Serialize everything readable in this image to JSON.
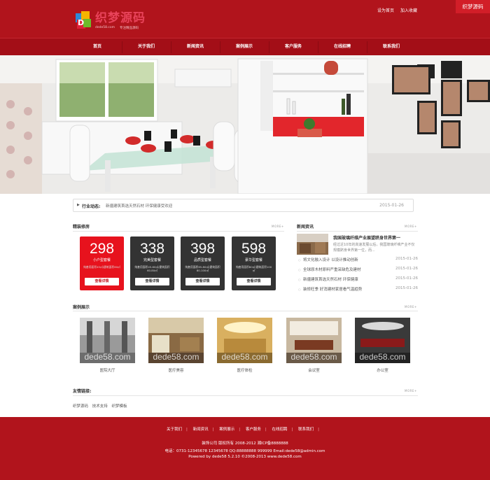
{
  "header": {
    "logo_text": "织梦源码",
    "logo_en": "dede58.com",
    "logo_slogan": "专注精品源码",
    "top_links": [
      "设为首页",
      "加入收藏"
    ],
    "corner_badge": "织梦源码"
  },
  "nav": [
    "首页",
    "关于我们",
    "新闻资讯",
    "案例展示",
    "客户服务",
    "在线招聘",
    "联系我们"
  ],
  "ticker": {
    "label": "行业动态:",
    "text": "新疆建筑首选天然石材 环保健康受欢迎",
    "date": "2015-01-26"
  },
  "packages_section": {
    "title": "精装修房",
    "more": "MORE+",
    "items": [
      {
        "price": "298",
        "name": "小户型套餐",
        "desc": "纯套用面积45㎡/建筑面积60㎡",
        "button": "查看详情"
      },
      {
        "price": "338",
        "name": "完美型套餐",
        "desc": "纯套用面积45-60㎡/建筑面积60-80㎡",
        "button": "查看详情"
      },
      {
        "price": "398",
        "name": "品质型套餐",
        "desc": "纯套用面积65-80㎡/建筑面积80-100㎡",
        "button": "查看详情"
      },
      {
        "price": "598",
        "name": "豪华型套餐",
        "desc": "纯套用面积80㎡/建筑面积100㎡",
        "button": "查看详情"
      }
    ]
  },
  "news_section": {
    "title": "新闻资讯",
    "more": "MORE+",
    "featured": {
      "title": "我国玻璃纤维产业展望跻身世界第一",
      "summary": "经过近10年的高速发展以后，我国玻璃纤维产业不仅规模跻身世界第一位，而..."
    },
    "items": [
      {
        "title": "将文化融入设计 以设计推动创新",
        "date": "2015-01-26"
      },
      {
        "title": "全球原木材原料严重采缺危及建材",
        "date": "2015-01-26"
      },
      {
        "title": "新疆建筑首选天然石材 环保健康",
        "date": "2015-01-26"
      },
      {
        "title": "装修旺季 好消建材家居看气温趋势",
        "date": "2015-01-26"
      }
    ]
  },
  "cases_section": {
    "title": "案例展示",
    "more": "MORE+",
    "watermark": "dede58.com",
    "items": [
      "医院大厅",
      "医疗美容",
      "医疗体检",
      "会议室",
      "办公室"
    ]
  },
  "links_section": {
    "title": "友情链接:",
    "more": "MORE+",
    "items": [
      "织梦源码",
      "技术支持",
      "织梦模板"
    ]
  },
  "footer": {
    "nav": [
      "关于我们",
      "新闻资讯",
      "案例展示",
      "客户服务",
      "在线招聘",
      "联系我们"
    ],
    "line1": "装饰公司 版权所有 2008-2012 湘ICP备8888888",
    "line2": "电话：0731-12345678 12345678 QQ:88888888 999999 Email:dede58@admin.com",
    "line3": "Powered by dede58 5.2.10 ©2008-2013 www.dede58.com"
  },
  "colors": {
    "brand_red": "#b1141c",
    "accent_red": "#e7121d",
    "dark": "#333333"
  }
}
